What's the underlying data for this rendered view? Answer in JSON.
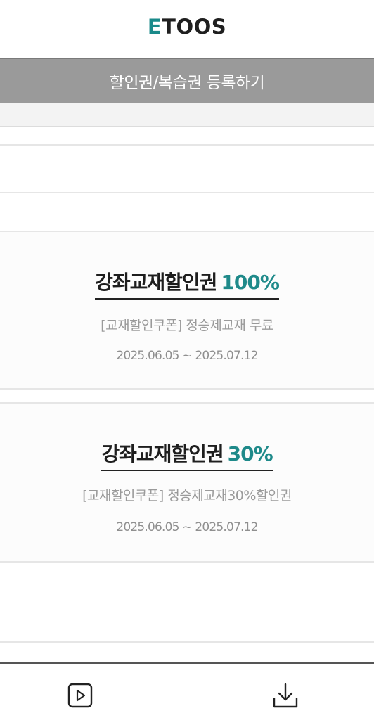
{
  "header": {
    "logo_accent": "E",
    "logo_rest": "TOOS"
  },
  "register": {
    "label": "할인권/복습권 등록하기"
  },
  "coupons": [
    {
      "title": "강좌교재할인권",
      "percent": "100%",
      "description": "[교재할인쿠폰] 정승제교재 무료",
      "period": "2025.06.05 ~ 2025.07.12"
    },
    {
      "title": "강좌교재할인권",
      "percent": "30%",
      "description": "[교재할인쿠폰] 정승제교재30%할인권",
      "period": "2025.06.05 ~ 2025.07.12"
    }
  ],
  "bottom_bar": {
    "left_icon": "play-icon",
    "right_icon": "download-icon"
  },
  "colors": {
    "accent": "#1f8a8a",
    "register_bg": "#9a9a9a"
  }
}
